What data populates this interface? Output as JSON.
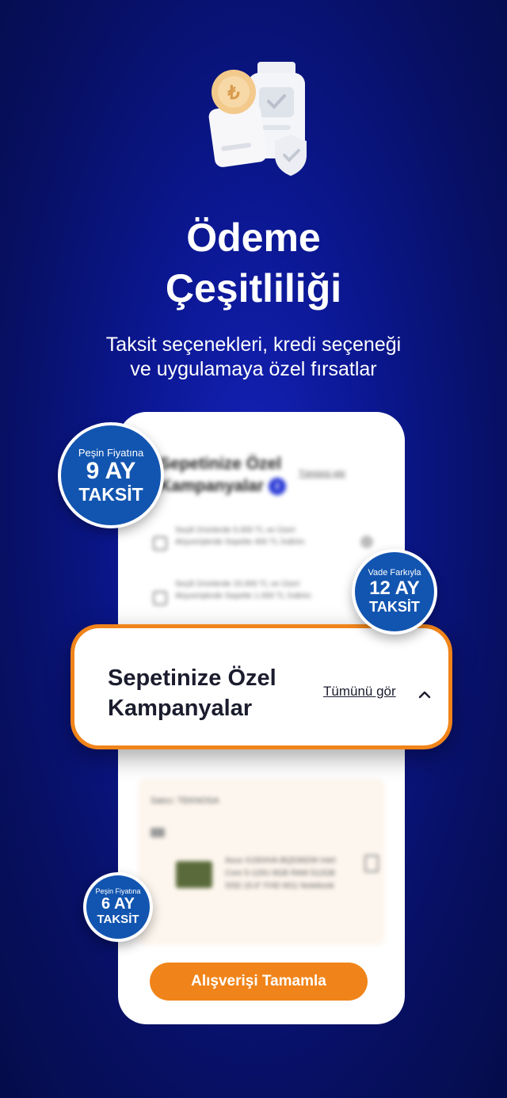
{
  "hero": {
    "title_line1": "Ödeme",
    "title_line2": "Çeşitliliği",
    "subtitle_line1": "Taksit seçenekleri, kredi seçeneği",
    "subtitle_line2": "ve uygulamaya özel fırsatlar"
  },
  "phone": {
    "blurred_title_line1": "Sepetinize Özel",
    "blurred_title_line2": "Kampanyalar",
    "blurred_count": "2",
    "blurred_see_all": "Tümünü gör",
    "blurred_offer1": "Seçili Ürünlerde 5.000 TL ve Üzeri Alışverişlerde Sepette 400 TL İndirim",
    "blurred_offer2": "Seçili Ürünlerde 15.000 TL ve Üzeri Alışverişlerde Sepette 1.000 TL İndirim",
    "blurred_seller": "Satıcı: TEKNOSA",
    "blurred_product": "Asus X1504VA-BQ536DW Intel Core 5-120U 8GB RAM 512GB SSD 15.6\" FHD W11 Notebook",
    "cta": "Alışverişi Tamamla"
  },
  "popup": {
    "title_line1": "Sepetinize Özel",
    "title_line2": "Kampanyalar",
    "see_all": "Tümünü gör"
  },
  "badges": [
    {
      "top": "Peşin Fiyatına",
      "mid": "9 AY",
      "bot": "TAKSİT"
    },
    {
      "top": "Vade Farkıyla",
      "mid": "12 AY",
      "bot": "TAKSİT"
    },
    {
      "top": "Peşin Fiyatına",
      "mid": "6 AY",
      "bot": "TAKSİT"
    }
  ],
  "colors": {
    "accent": "#f0841a",
    "badge": "#1255b0",
    "background": "#0b1790"
  }
}
